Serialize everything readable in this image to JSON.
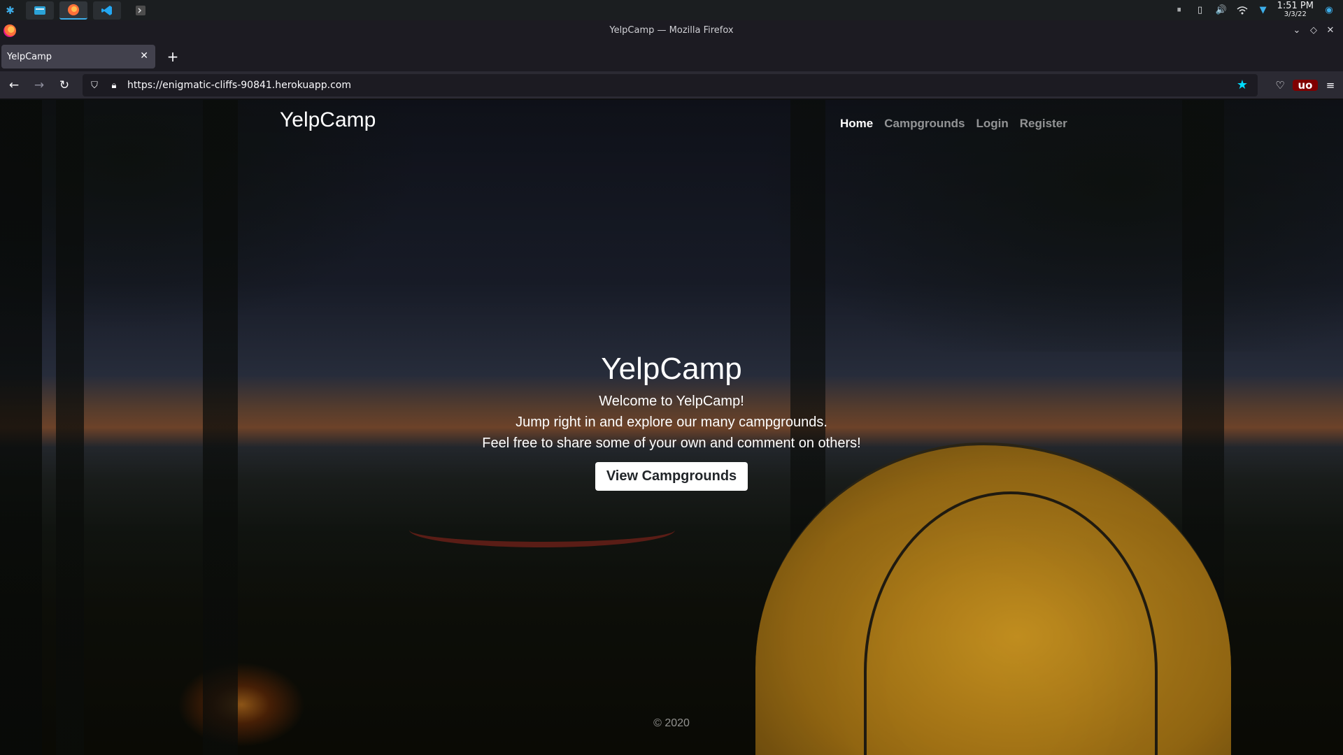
{
  "taskbar": {
    "launcher_icon": "kde-logo-icon",
    "tasks": [
      {
        "name": "file-manager-icon"
      },
      {
        "name": "firefox-icon"
      },
      {
        "name": "vscode-icon"
      },
      {
        "name": "terminal-icon"
      }
    ],
    "clock_time": "1:51 PM",
    "clock_date": "3/3/22"
  },
  "window": {
    "title": "YelpCamp — Mozilla Firefox"
  },
  "browser": {
    "tab_title": "YelpCamp",
    "url": "https://enigmatic-cliffs-90841.herokuapp.com",
    "ublock_label": "uo",
    "colors": {
      "star": "#00ddff",
      "chrome_dark": "#1c1b22",
      "toolbar": "#2b2a33"
    }
  },
  "site": {
    "brand": "YelpCamp",
    "nav": {
      "home": "Home",
      "campgrounds": "Campgrounds",
      "login": "Login",
      "register": "Register"
    },
    "hero": {
      "title": "YelpCamp",
      "line1": "Welcome to YelpCamp!",
      "line2": "Jump right in and explore our many campgrounds.",
      "line3": "Feel free to share some of your own and comment on others!",
      "cta": "View Campgrounds"
    },
    "footer": "© 2020"
  }
}
